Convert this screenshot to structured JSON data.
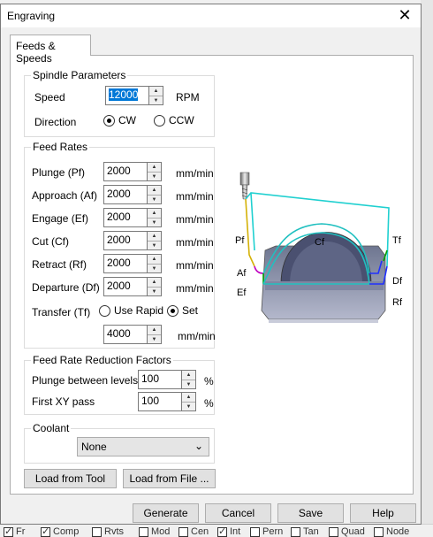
{
  "dialog": {
    "title": "Engraving"
  },
  "tabs": [
    {
      "label": "Feeds & Speeds"
    }
  ],
  "spindle": {
    "legend": "Spindle Parameters",
    "speed_label": "Speed",
    "speed_value": "12000",
    "speed_unit": "RPM",
    "direction_label": "Direction",
    "cw_label": "CW",
    "ccw_label": "CCW",
    "direction_selected": "CW"
  },
  "feed_rates": {
    "legend": "Feed Rates",
    "unit": "mm/min",
    "rows": [
      {
        "label": "Plunge (Pf)",
        "value": "2000"
      },
      {
        "label": "Approach (Af)",
        "value": "2000"
      },
      {
        "label": "Engage (Ef)",
        "value": "2000"
      },
      {
        "label": "Cut (Cf)",
        "value": "2000"
      },
      {
        "label": "Retract (Rf)",
        "value": "2000"
      },
      {
        "label": "Departure  (Df)",
        "value": "2000"
      }
    ],
    "transfer_label": "Transfer (Tf)",
    "use_rapid_label": "Use Rapid",
    "set_label": "Set",
    "transfer_selected": "Set",
    "transfer_value": "4000"
  },
  "reduction": {
    "legend": "Feed Rate Reduction Factors",
    "unit": "%",
    "rows": [
      {
        "label": "Plunge between levels",
        "value": "100"
      },
      {
        "label": "First XY pass",
        "value": "100"
      }
    ]
  },
  "coolant": {
    "legend": "Coolant",
    "value": "None"
  },
  "load_buttons": {
    "from_tool": "Load from Tool",
    "from_file": "Load from File ..."
  },
  "footer_buttons": {
    "generate": "Generate",
    "cancel": "Cancel",
    "save": "Save",
    "help": "Help"
  },
  "diagram_labels": {
    "pf": "Pf",
    "cf": "Cf",
    "tf": "Tf",
    "af": "Af",
    "ef": "Ef",
    "df": "Df",
    "rf": "Rf"
  },
  "diagram_colors": {
    "plunge": "#d4b106",
    "approach": "#c000c0",
    "engage": "#00a000",
    "cut": "#20c0c0",
    "transfer": "#20d0d0",
    "depart": "#2030ff",
    "part": "#9aa0b8"
  },
  "background": {
    "status_items": [
      {
        "label": "Fr",
        "checked": true
      },
      {
        "label": "Comp",
        "checked": true
      },
      {
        "label": "Rvts",
        "checked": false
      },
      {
        "label": "Mod",
        "checked": false
      },
      {
        "label": "Cen",
        "checked": false
      },
      {
        "label": "Int",
        "checked": true
      },
      {
        "label": "Pern",
        "checked": false
      },
      {
        "label": "Tan",
        "checked": false
      },
      {
        "label": "Quad",
        "checked": false
      },
      {
        "label": "Node",
        "checked": false
      }
    ]
  }
}
